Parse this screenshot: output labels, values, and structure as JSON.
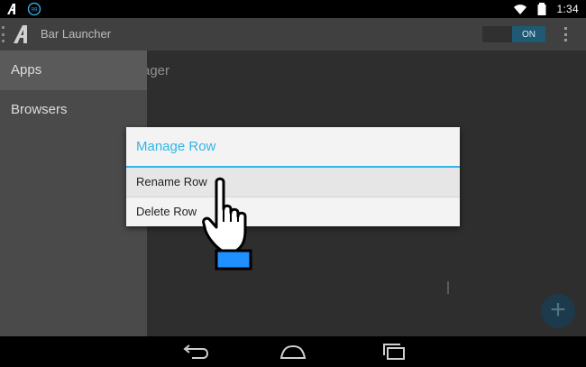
{
  "status_bar": {
    "time": "1:34",
    "notification_badge": "99",
    "icons": [
      "app-logo-icon",
      "notification-badge-icon",
      "wifi-icon",
      "battery-icon"
    ]
  },
  "action_bar": {
    "title": "Bar Launcher",
    "toggle_label": "ON",
    "icons": [
      "drawer-indicator-icon",
      "app-logo-icon",
      "overflow-menu-icon"
    ]
  },
  "background": {
    "partial_text": "ager",
    "fab_label": "+"
  },
  "drawer": {
    "items": [
      {
        "label": "Apps",
        "selected": true
      },
      {
        "label": "Browsers",
        "selected": false
      }
    ]
  },
  "dialog": {
    "title": "Manage Row",
    "items": [
      {
        "label": "Rename Row",
        "pressed": true
      },
      {
        "label": "Delete Row",
        "pressed": false
      }
    ]
  },
  "nav_bar": {
    "icons": [
      "back-icon",
      "home-icon",
      "recent-apps-icon"
    ]
  },
  "colors": {
    "accent": "#33b5e5",
    "action_bar": "#404040",
    "drawer": "#4a4a4a",
    "dialog_bg": "#f3f3f3",
    "pointer_cuff": "#1e90ff"
  }
}
